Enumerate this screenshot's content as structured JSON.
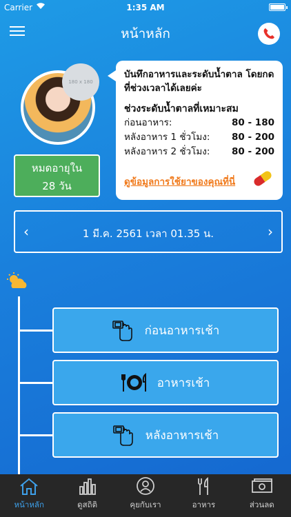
{
  "status_bar": {
    "carrier": "Carrier",
    "time": "1:35 AM"
  },
  "header": {
    "title": "หน้าหลัก"
  },
  "avatar_badge": "180 x 180",
  "expiry": {
    "line1": "หมดอายุใน",
    "line2": "28 วัน"
  },
  "info_card": {
    "intro": "บันทึกอาหารและระดับน้ำตาล โดยกดที่ช่วงเวลาได้เลยค่ะ",
    "range_title": "ช่วงระดับน้ำตาลที่เหมาะสม",
    "ranges": [
      {
        "label": "ก่อนอาหาร:",
        "value": "80 - 180"
      },
      {
        "label": "หลังอาหาร 1 ชั่วโมง:",
        "value": "80 - 200"
      },
      {
        "label": "หลังอาหาร 2 ชั่วโมง:",
        "value": "80 - 200"
      }
    ],
    "medication_link": "ดูข้อมูลการใช้ยาของคุณที่นี่"
  },
  "date_bar": {
    "text": "1 มี.ค. 2561 เวลา 01.35 น.",
    "prev": "‹",
    "next": "›"
  },
  "meals": [
    {
      "label": "ก่อนอาหารเช้า",
      "icon": "glucose-meter-icon"
    },
    {
      "label": "อาหารเช้า",
      "icon": "plate-fork-knife-icon"
    },
    {
      "label": "หลังอาหารเช้า",
      "icon": "glucose-meter-icon"
    }
  ],
  "tabs": [
    {
      "label": "หน้าหลัก",
      "icon": "home-icon",
      "active": true
    },
    {
      "label": "ดูสถิติ",
      "icon": "bar-chart-icon",
      "active": false
    },
    {
      "label": "คุยกับเรา",
      "icon": "chat-person-icon",
      "active": false
    },
    {
      "label": "อาหาร",
      "icon": "fork-knife-icon",
      "active": false
    },
    {
      "label": "ส่วนลด",
      "icon": "money-icon",
      "active": false
    }
  ],
  "colors": {
    "accent": "#1a7fdc",
    "expiry_green": "#4dae5b",
    "link_orange": "#f07a1c",
    "active_tab": "#3ea0ea",
    "tab_bar": "#272727"
  }
}
